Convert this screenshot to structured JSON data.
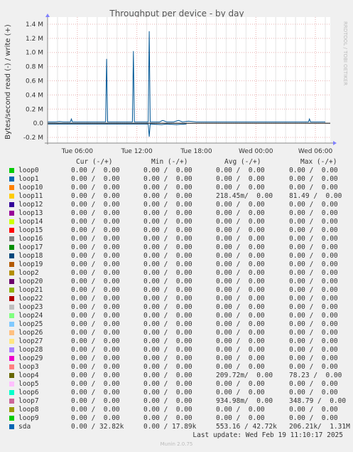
{
  "chart_data": {
    "type": "line",
    "title": "Throughput per device - by day",
    "ylabel": "Bytes/second read (-) / write (+)",
    "ylim": [
      -0.28,
      1.5
    ],
    "y_ticks": [
      {
        "v": 1.4,
        "label": "1.4 M"
      },
      {
        "v": 1.2,
        "label": "1.2 M"
      },
      {
        "v": 1.0,
        "label": "1.0 M"
      },
      {
        "v": 0.8,
        "label": "0.8 M"
      },
      {
        "v": 0.6,
        "label": "0.6 M"
      },
      {
        "v": 0.4,
        "label": "0.4 M"
      },
      {
        "v": 0.2,
        "label": "0.2 M"
      },
      {
        "v": 0.0,
        "label": "0.0"
      },
      {
        "v": -0.2,
        "label": "-0.2 M"
      }
    ],
    "xlim": [
      0,
      28.5
    ],
    "x_ticks": [
      {
        "v": 3,
        "label": "Tue 06:00"
      },
      {
        "v": 9,
        "label": "Tue 12:00"
      },
      {
        "v": 15,
        "label": "Tue 18:00"
      },
      {
        "v": 21,
        "label": "Wed 00:00"
      },
      {
        "v": 27,
        "label": "Wed 06:00"
      }
    ],
    "grid": true,
    "series": [
      {
        "name": "sda",
        "color": "#005796",
        "points": [
          [
            0,
            0.02
          ],
          [
            0.4,
            0.02
          ],
          [
            0.8,
            0.02
          ],
          [
            1.2,
            0.025
          ],
          [
            1.6,
            0.02
          ],
          [
            2.0,
            0.02
          ],
          [
            2.3,
            0.02
          ],
          [
            2.4,
            0.06
          ],
          [
            2.5,
            0.02
          ],
          [
            3.0,
            0.02
          ],
          [
            3.5,
            0.02
          ],
          [
            4.0,
            0.02
          ],
          [
            4.8,
            0.02
          ],
          [
            5.6,
            0.02
          ],
          [
            5.85,
            0.02
          ],
          [
            5.95,
            0.91
          ],
          [
            6.05,
            0.02
          ],
          [
            6.5,
            0.02
          ],
          [
            7.0,
            0.02
          ],
          [
            7.8,
            0.02
          ],
          [
            8.3,
            0.02
          ],
          [
            8.55,
            0.02
          ],
          [
            8.65,
            1.02
          ],
          [
            8.75,
            0.02
          ],
          [
            9.2,
            0.02
          ],
          [
            9.8,
            0.02
          ],
          [
            10.15,
            0.02
          ],
          [
            10.25,
            1.3
          ],
          [
            10.35,
            0.02
          ],
          [
            10.8,
            0.02
          ],
          [
            11.3,
            0.02
          ],
          [
            11.6,
            0.04
          ],
          [
            12.0,
            0.02
          ],
          [
            12.7,
            0.02
          ],
          [
            13.2,
            0.04
          ],
          [
            13.6,
            0.02
          ],
          [
            14.2,
            0.03
          ],
          [
            15.0,
            0.02
          ],
          [
            15.8,
            0.02
          ],
          [
            16.5,
            0.02
          ],
          [
            17.3,
            0.02
          ],
          [
            18.0,
            0.02
          ],
          [
            18.8,
            0.02
          ],
          [
            19.6,
            0.02
          ],
          [
            20.4,
            0.02
          ],
          [
            21.2,
            0.02
          ],
          [
            22.0,
            0.02
          ],
          [
            22.8,
            0.02
          ],
          [
            23.6,
            0.02
          ],
          [
            24.4,
            0.02
          ],
          [
            25.2,
            0.02
          ],
          [
            26.0,
            0.02
          ],
          [
            26.3,
            0.02
          ],
          [
            26.4,
            0.06
          ],
          [
            26.5,
            0.02
          ],
          [
            27.0,
            0.02
          ],
          [
            28.0,
            0.02
          ],
          [
            28.6,
            0.02
          ],
          [
            28.7,
            0.94
          ],
          [
            28.8,
            0.02
          ],
          [
            28.9,
            0.02
          ],
          [
            29.2,
            0.02
          ],
          [
            29.3,
            0.57
          ],
          [
            29.4,
            0.02
          ],
          [
            30.2,
            0.02
          ],
          [
            31.6,
            0.02
          ]
        ],
        "read_points": [
          [
            0,
            -0.01
          ],
          [
            10.15,
            -0.01
          ],
          [
            10.25,
            -0.19
          ],
          [
            10.35,
            -0.01
          ],
          [
            11.5,
            -0.02
          ],
          [
            12.0,
            -0.01
          ],
          [
            13.0,
            -0.02
          ],
          [
            14.0,
            -0.01
          ],
          [
            31.6,
            -0.01
          ]
        ]
      }
    ],
    "legend": {
      "headers": {
        "cur": "Cur (-/+)",
        "min": "Min (-/+)",
        "avg": "Avg (-/+)",
        "max": "Max (-/+)"
      },
      "rows": [
        {
          "name": "loop0",
          "color": "#00cc00",
          "cur": "0.00 /  0.00",
          "min": "0.00 /  0.00",
          "avg": "0.00 /  0.00",
          "max": "0.00 /  0.00"
        },
        {
          "name": "loop1",
          "color": "#0066b3",
          "cur": "0.00 /  0.00",
          "min": "0.00 /  0.00",
          "avg": "0.00 /  0.00",
          "max": "0.00 /  0.00"
        },
        {
          "name": "loop10",
          "color": "#ff8000",
          "cur": "0.00 /  0.00",
          "min": "0.00 /  0.00",
          "avg": "0.00 /  0.00",
          "max": "0.00 /  0.00"
        },
        {
          "name": "loop11",
          "color": "#ffcc00",
          "cur": "0.00 /  0.00",
          "min": "0.00 /  0.00",
          "avg": "218.45m/  0.00",
          "max": "81.49 /  0.00"
        },
        {
          "name": "loop12",
          "color": "#330099",
          "cur": "0.00 /  0.00",
          "min": "0.00 /  0.00",
          "avg": "0.00 /  0.00",
          "max": "0.00 /  0.00"
        },
        {
          "name": "loop13",
          "color": "#990099",
          "cur": "0.00 /  0.00",
          "min": "0.00 /  0.00",
          "avg": "0.00 /  0.00",
          "max": "0.00 /  0.00"
        },
        {
          "name": "loop14",
          "color": "#ccff00",
          "cur": "0.00 /  0.00",
          "min": "0.00 /  0.00",
          "avg": "0.00 /  0.00",
          "max": "0.00 /  0.00"
        },
        {
          "name": "loop15",
          "color": "#ff0000",
          "cur": "0.00 /  0.00",
          "min": "0.00 /  0.00",
          "avg": "0.00 /  0.00",
          "max": "0.00 /  0.00"
        },
        {
          "name": "loop16",
          "color": "#808080",
          "cur": "0.00 /  0.00",
          "min": "0.00 /  0.00",
          "avg": "0.00 /  0.00",
          "max": "0.00 /  0.00"
        },
        {
          "name": "loop17",
          "color": "#008f00",
          "cur": "0.00 /  0.00",
          "min": "0.00 /  0.00",
          "avg": "0.00 /  0.00",
          "max": "0.00 /  0.00"
        },
        {
          "name": "loop18",
          "color": "#00487d",
          "cur": "0.00 /  0.00",
          "min": "0.00 /  0.00",
          "avg": "0.00 /  0.00",
          "max": "0.00 /  0.00"
        },
        {
          "name": "loop19",
          "color": "#b35a00",
          "cur": "0.00 /  0.00",
          "min": "0.00 /  0.00",
          "avg": "0.00 /  0.00",
          "max": "0.00 /  0.00"
        },
        {
          "name": "loop2",
          "color": "#b38f00",
          "cur": "0.00 /  0.00",
          "min": "0.00 /  0.00",
          "avg": "0.00 /  0.00",
          "max": "0.00 /  0.00"
        },
        {
          "name": "loop20",
          "color": "#6b006b",
          "cur": "0.00 /  0.00",
          "min": "0.00 /  0.00",
          "avg": "0.00 /  0.00",
          "max": "0.00 /  0.00"
        },
        {
          "name": "loop21",
          "color": "#8fb300",
          "cur": "0.00 /  0.00",
          "min": "0.00 /  0.00",
          "avg": "0.00 /  0.00",
          "max": "0.00 /  0.00"
        },
        {
          "name": "loop22",
          "color": "#b30000",
          "cur": "0.00 /  0.00",
          "min": "0.00 /  0.00",
          "avg": "0.00 /  0.00",
          "max": "0.00 /  0.00"
        },
        {
          "name": "loop23",
          "color": "#bebebe",
          "cur": "0.00 /  0.00",
          "min": "0.00 /  0.00",
          "avg": "0.00 /  0.00",
          "max": "0.00 /  0.00"
        },
        {
          "name": "loop24",
          "color": "#80ff80",
          "cur": "0.00 /  0.00",
          "min": "0.00 /  0.00",
          "avg": "0.00 /  0.00",
          "max": "0.00 /  0.00"
        },
        {
          "name": "loop25",
          "color": "#80c9ff",
          "cur": "0.00 /  0.00",
          "min": "0.00 /  0.00",
          "avg": "0.00 /  0.00",
          "max": "0.00 /  0.00"
        },
        {
          "name": "loop26",
          "color": "#ffc080",
          "cur": "0.00 /  0.00",
          "min": "0.00 /  0.00",
          "avg": "0.00 /  0.00",
          "max": "0.00 /  0.00"
        },
        {
          "name": "loop27",
          "color": "#ffe680",
          "cur": "0.00 /  0.00",
          "min": "0.00 /  0.00",
          "avg": "0.00 /  0.00",
          "max": "0.00 /  0.00"
        },
        {
          "name": "loop28",
          "color": "#aa80ff",
          "cur": "0.00 /  0.00",
          "min": "0.00 /  0.00",
          "avg": "0.00 /  0.00",
          "max": "0.00 /  0.00"
        },
        {
          "name": "loop29",
          "color": "#ee00cc",
          "cur": "0.00 /  0.00",
          "min": "0.00 /  0.00",
          "avg": "0.00 /  0.00",
          "max": "0.00 /  0.00"
        },
        {
          "name": "loop3",
          "color": "#ff8080",
          "cur": "0.00 /  0.00",
          "min": "0.00 /  0.00",
          "avg": "0.00 /  0.00",
          "max": "0.00 /  0.00"
        },
        {
          "name": "loop4",
          "color": "#666600",
          "cur": "0.00 /  0.00",
          "min": "0.00 /  0.00",
          "avg": "209.72m/  0.00",
          "max": "78.23 /  0.00"
        },
        {
          "name": "loop5",
          "color": "#ffbfff",
          "cur": "0.00 /  0.00",
          "min": "0.00 /  0.00",
          "avg": "0.00 /  0.00",
          "max": "0.00 /  0.00"
        },
        {
          "name": "loop6",
          "color": "#00ffcc",
          "cur": "0.00 /  0.00",
          "min": "0.00 /  0.00",
          "avg": "0.00 /  0.00",
          "max": "0.00 /  0.00"
        },
        {
          "name": "loop7",
          "color": "#cc6699",
          "cur": "0.00 /  0.00",
          "min": "0.00 /  0.00",
          "avg": "934.98m/  0.00",
          "max": "348.79 /  0.00"
        },
        {
          "name": "loop8",
          "color": "#999900",
          "cur": "0.00 /  0.00",
          "min": "0.00 /  0.00",
          "avg": "0.00 /  0.00",
          "max": "0.00 /  0.00"
        },
        {
          "name": "loop9",
          "color": "#00cc00",
          "cur": "0.00 /  0.00",
          "min": "0.00 /  0.00",
          "avg": "0.00 /  0.00",
          "max": "0.00 /  0.00"
        },
        {
          "name": "sda",
          "color": "#0066b3",
          "cur": "0.00 / 32.82k",
          "min": "0.00 / 17.89k",
          "avg": "553.16 / 42.72k",
          "max": "206.21k/  1.31M"
        }
      ]
    }
  },
  "last_update": "Last update: Wed Feb 19 11:10:17 2025",
  "footer": "Munin 2.0.75",
  "watermark": "RRDTOOL / TOBI OETIKER"
}
